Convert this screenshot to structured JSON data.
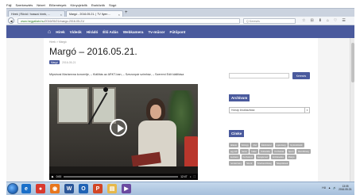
{
  "browser": {
    "menu": [
      "Fájl",
      "Szerkesztés",
      "Nézet",
      "Előzmények",
      "Könyvjelzők",
      "Eszközök",
      "Súgó"
    ],
    "tabs": [
      {
        "label": "Hírek | Rövid / hosszú hírek, ...",
        "active": false
      },
      {
        "label": "Margó - 2016.05.21. | TV Ilyen ...",
        "active": true
      }
    ],
    "new_tab": "+",
    "url_host": "www.hegyaliatv.hu",
    "url_rest": "/2016/05/21/margo-2016-05-21/",
    "search_placeholder": "Q Keresés",
    "nav_icons": [
      "star-icon",
      "bookmark-icon",
      "download-icon",
      "home-icon",
      "pocket-icon",
      "menu-icon"
    ]
  },
  "site": {
    "nav": [
      "Hírek",
      "Videók",
      "Hírádó",
      "Élő Adás",
      "Webkamera",
      "Tv-műsor",
      "Fűtőpont"
    ],
    "accent": "#4a5a9d"
  },
  "article": {
    "breadcrumb": "Hírek > Margó",
    "title": "Margó – 2016.05.21.",
    "category": "Margó",
    "date": "2016-05-21",
    "summary": "Mipsinosi Mariannna koncertje, – Kiállítás az ARKT-ban, – Szezonpár szimház, – Szeremi Edit kiállítása"
  },
  "video": {
    "time": "0:00",
    "duration": "12:47",
    "progress": 0.0
  },
  "sidebar": {
    "search_button": "Keresés",
    "archive_title": "Archívum",
    "archive_select": "Hónap kiválasztása",
    "tags_title": "Címke",
    "tags": [
      "állatok",
      "bűnügy",
      "disz",
      "Élelmiszer",
      "egészség",
      "Gyümölcsök",
      "egy-Mi",
      "hazai",
      "határ",
      "Kulturális",
      "Kórházak",
      "Sport",
      "Rendőrség",
      "kedvére",
      "Kertvárosi",
      "hanglemez",
      "közlekedés",
      "Margó",
      "rendezvény",
      "Szerk.",
      "Szerkesztőség",
      "Települések"
    ]
  },
  "taskbar": {
    "apps": [
      {
        "name": "explorer-icon",
        "glyph": "e",
        "color": "#1a6fc9"
      },
      {
        "name": "chrome-icon",
        "glyph": "●",
        "color": "#d9392e"
      },
      {
        "name": "firefox-icon",
        "glyph": "◉",
        "color": "#e8761c"
      },
      {
        "name": "word-icon",
        "glyph": "W",
        "color": "#2a5699"
      },
      {
        "name": "outlook-icon",
        "glyph": "O",
        "color": "#1f63b5"
      },
      {
        "name": "powerpoint-icon",
        "glyph": "P",
        "color": "#d24726"
      },
      {
        "name": "folder-icon",
        "glyph": "▤",
        "color": "#e6b84a"
      },
      {
        "name": "media-icon",
        "glyph": "▶",
        "color": "#6a4aa0"
      }
    ],
    "tray": [
      "HU",
      "▲",
      "🔊"
    ],
    "time": "13:05",
    "date": "2016.05.23."
  }
}
